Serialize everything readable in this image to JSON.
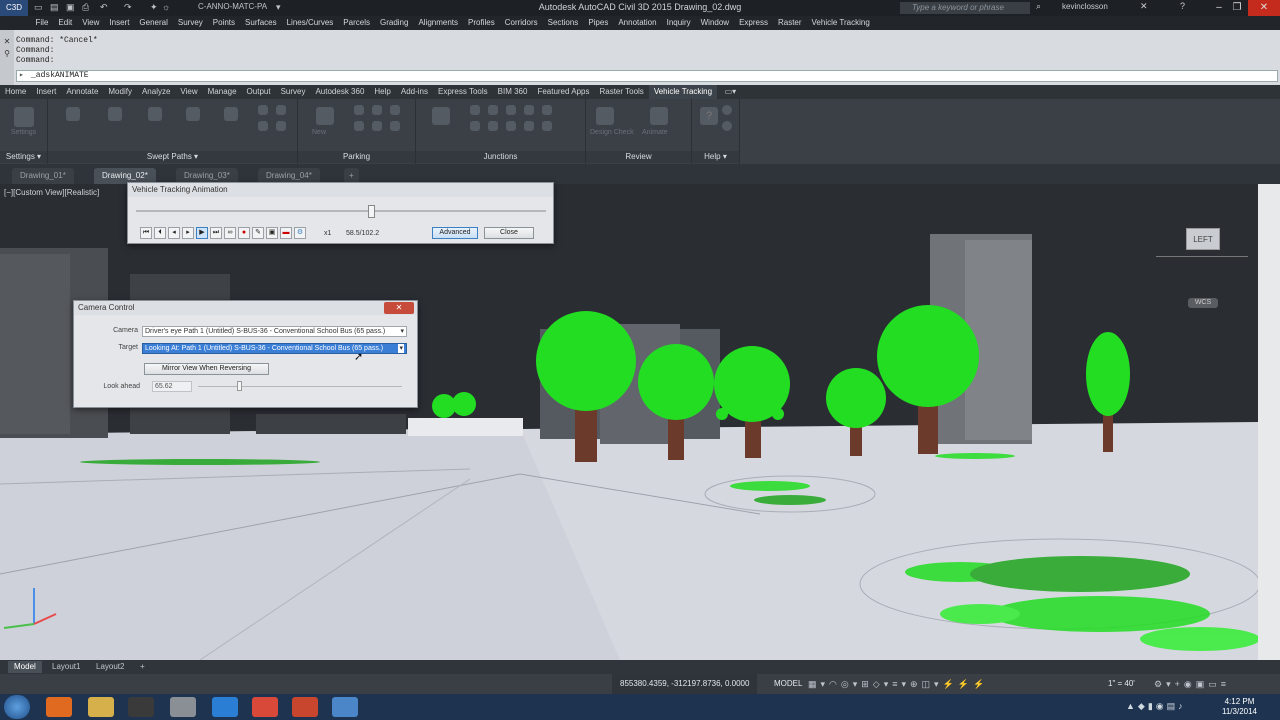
{
  "app": {
    "title": "Autodesk AutoCAD Civil 3D 2015    Drawing_02.dwg",
    "app_button": "C3D",
    "workspace": "C-ANNO-MATC-PA",
    "search_placeholder": "Type a keyword or phrase",
    "user": "kevinclosson"
  },
  "menubar": [
    "File",
    "Edit",
    "View",
    "Insert",
    "General",
    "Survey",
    "Points",
    "Surfaces",
    "Lines/Curves",
    "Parcels",
    "Grading",
    "Alignments",
    "Profiles",
    "Corridors",
    "Sections",
    "Pipes",
    "Annotation",
    "Inquiry",
    "Window",
    "Express",
    "Raster",
    "Vehicle Tracking"
  ],
  "command": {
    "history": [
      "Command: *Cancel*",
      "Command:",
      "Command:"
    ],
    "input": "_adskANIMATE"
  },
  "ribbon_tabs": [
    "Home",
    "Insert",
    "Annotate",
    "Modify",
    "Analyze",
    "View",
    "Manage",
    "Output",
    "Survey",
    "Autodesk 360",
    "Help",
    "Add-ins",
    "Express Tools",
    "BIM 360",
    "Featured Apps",
    "Raster Tools",
    "Vehicle Tracking"
  ],
  "ribbon_active": "Vehicle Tracking",
  "ribbon_panels": {
    "settings": "Settings",
    "swept_paths": "Swept Paths",
    "parking": "Parking",
    "junctions": "Junctions",
    "review": "Review",
    "help": "Help"
  },
  "ribbon_buttons": {
    "settings": "Settings",
    "new_vehicle": "New",
    "design_check": "Design Check",
    "animate": "Animate"
  },
  "doc_tabs": [
    "Drawing_01*",
    "Drawing_02*",
    "Drawing_03*",
    "Drawing_04*"
  ],
  "doc_active": "Drawing_02*",
  "viewport": {
    "label": "[−][Custom View][Realistic]",
    "viewcube": "LEFT",
    "wcs": "WCS"
  },
  "vt_anim": {
    "title": "Vehicle Tracking Animation",
    "speed": "x1",
    "progress_text": "58.5/102.2",
    "progress": 0.572,
    "advanced": "Advanced",
    "close": "Close"
  },
  "camera": {
    "title": "Camera Control",
    "camera_label": "Camera",
    "camera_value": "Driver's eye Path 1 (Untitled) S-BUS-36 - Conventional School Bus (65 pass.)",
    "target_label": "Target",
    "target_value": "Looking At: Path 1 (Untitled) S-BUS-36 - Conventional School Bus (65 pass.)",
    "mirror": "Mirror View When Reversing",
    "lookahead_label": "Look ahead",
    "lookahead_value": "65.62",
    "lookahead_level": 0.2
  },
  "layout_tabs": [
    "Model",
    "Layout1",
    "Layout2"
  ],
  "status": {
    "coords": "855380.4359, -312197.8736, 0.0000",
    "model": "MODEL",
    "scale": "1\" = 40'"
  },
  "clock": {
    "time": "4:12 PM",
    "date": "11/3/2014"
  },
  "colors": {
    "tree_green": "#22dd22",
    "trunk": "#6b3a2a",
    "accent": "#3a7ed6"
  }
}
